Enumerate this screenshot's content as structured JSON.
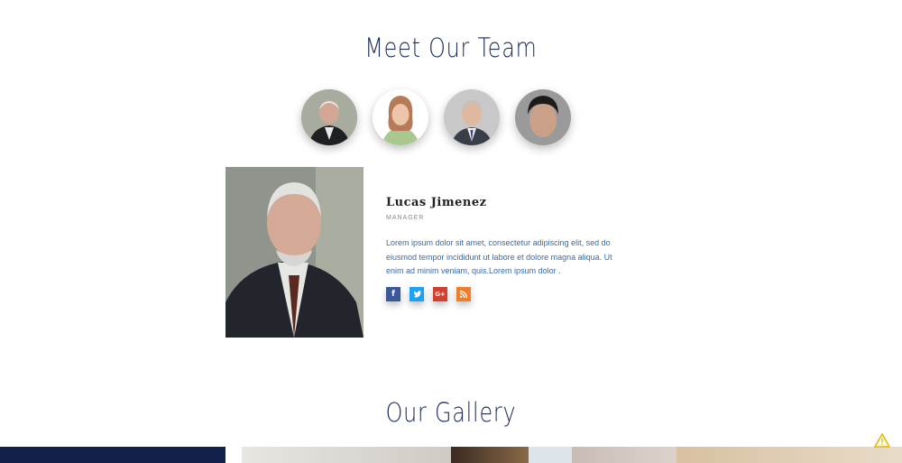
{
  "team": {
    "title": "Meet Our Team",
    "members": [
      {
        "name": "Lucas Jimenez",
        "role": "MANAGER"
      }
    ],
    "selected": {
      "name": "Lucas Jimenez",
      "role": "MANAGER",
      "description": "Lorem ipsum dolor sit amet, consectetur adipiscing elit, sed do eiusmod tempor incididunt ut labore et dolore magna aliqua. Ut enim ad minim veniam, quis.Lorem ipsum dolor ."
    },
    "social": [
      {
        "icon": "facebook-icon",
        "glyph": "f",
        "color": "#3b5998"
      },
      {
        "icon": "twitter-icon",
        "glyph": "t",
        "color": "#1da1f2"
      },
      {
        "icon": "google-plus-icon",
        "glyph": "G+",
        "color": "#d0402f"
      },
      {
        "icon": "rss-icon",
        "glyph": "rss",
        "color": "#ee7d2c"
      }
    ]
  },
  "gallery": {
    "title": "Our Gallery"
  },
  "colors": {
    "heading": "#1a2a5a",
    "description": "#3a6aa8"
  }
}
